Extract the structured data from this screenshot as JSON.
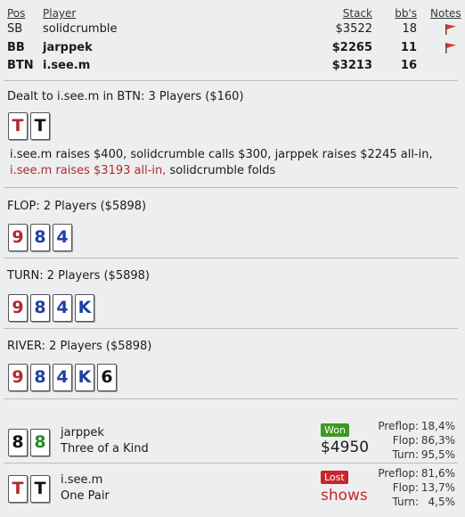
{
  "header": {
    "pos": "Pos",
    "player": "Player",
    "stack": "Stack",
    "bbs": "bb's",
    "notes": "Notes"
  },
  "players": [
    {
      "pos": "SB",
      "name": "solidcrumble",
      "stack": "$3522",
      "bbs": "18"
    },
    {
      "pos": "BB",
      "name": "jarppek",
      "stack": "$2265",
      "bbs": "11"
    },
    {
      "pos": "BTN",
      "name": "i.see.m",
      "stack": "$3213",
      "bbs": "16"
    }
  ],
  "preflop": {
    "title": "Dealt to i.see.m in BTN: 3 Players ($160)",
    "cards": [
      "T",
      "T"
    ],
    "action_main": "i.see.m raises $400, solidcrumble calls $300, jarppek raises $2245 all-in, ",
    "action_red": "i.see.m raises $3193 all-in,",
    "action_tail": " solidcrumble folds"
  },
  "flop": {
    "title": "FLOP: 2 Players ($5898)",
    "cards": [
      "9",
      "8",
      "4"
    ]
  },
  "turn": {
    "title": "TURN: 2 Players ($5898)",
    "cards": [
      "9",
      "8",
      "4",
      "K"
    ]
  },
  "river": {
    "title": "RIVER: 2 Players ($5898)",
    "cards": [
      "9",
      "8",
      "4",
      "K",
      "6"
    ]
  },
  "showdown": [
    {
      "name": "jarppek",
      "hand": "Three of a Kind",
      "cards": [
        "8",
        "8"
      ],
      "result_badge": "Won",
      "result_value": "$4950",
      "stats": [
        {
          "label": "Preflop:",
          "value": "18,4%"
        },
        {
          "label": "Flop:",
          "value": "86,3%"
        },
        {
          "label": "Turn:",
          "value": "95,5%"
        }
      ]
    },
    {
      "name": "i.see.m",
      "hand": "One Pair",
      "cards": [
        "T",
        "T"
      ],
      "result_badge": "Lost",
      "result_value": "shows",
      "stats": [
        {
          "label": "Preflop:",
          "value": "81,6%"
        },
        {
          "label": "Flop:",
          "value": "13,7%"
        },
        {
          "label": "Turn:",
          "value": "4,5%"
        }
      ]
    }
  ],
  "colors": {
    "hearts": "#b3282d",
    "diamonds": "#1f3fa0",
    "clubs": "#2a8a2a",
    "spades": "#111111",
    "won": "#3c9a1e",
    "lost": "#c7262b"
  },
  "icons": {
    "note_flag": "flag-icon"
  }
}
